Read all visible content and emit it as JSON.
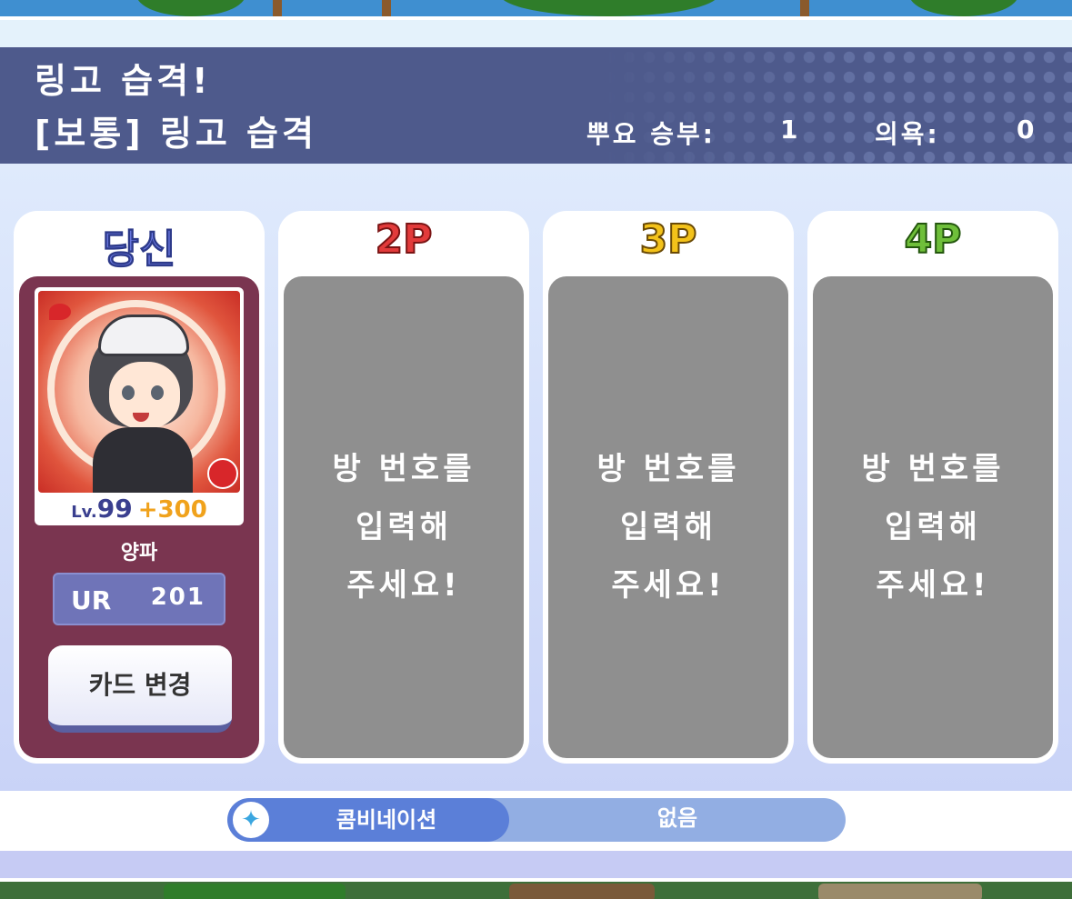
{
  "header": {
    "quest_title": "링고 습격!",
    "stage_title": "[보통] 링고 습격",
    "battle_label": "뿌요 승부:",
    "battle_value": "1",
    "motivation_label": "의욕:",
    "motivation_value": "0"
  },
  "players": {
    "you": {
      "label": "당신",
      "label_color": "#6f7de6",
      "card": {
        "lv_prefix": "Lv.",
        "level": "99",
        "bonus": "+300",
        "name": "양파",
        "rarity": "UR",
        "power": "201"
      },
      "change_button": "카드 변경"
    },
    "p2": {
      "label": "2P",
      "label_color": "#e23b3b",
      "msg_line1": "방 번호를",
      "msg_line2": "입력해",
      "msg_line3": "주세요!"
    },
    "p3": {
      "label": "3P",
      "label_color": "#f3c21a",
      "msg_line1": "방 번호를",
      "msg_line2": "입력해",
      "msg_line3": "주세요!"
    },
    "p4": {
      "label": "4P",
      "label_color": "#6fbf3a",
      "msg_line1": "방 번호를",
      "msg_line2": "입력해",
      "msg_line3": "주세요!"
    }
  },
  "combination": {
    "icon": "sparkle-icon",
    "label": "콤비네이션",
    "value": "없음"
  }
}
